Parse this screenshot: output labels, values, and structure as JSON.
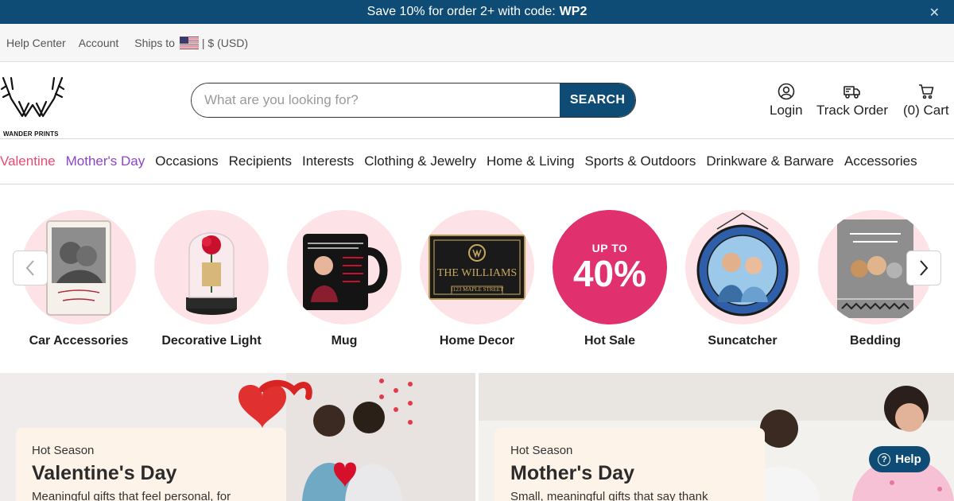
{
  "announcement": {
    "text": "Save 10% for order 2+ with code:",
    "code": "WP2",
    "close_icon": "close-icon"
  },
  "utility": {
    "help_center": "Help Center",
    "account": "Account",
    "ships_to": "Ships to",
    "currency": "| $ (USD)"
  },
  "header": {
    "logo_text": "WANDER PRINTS",
    "search_placeholder": "What are you looking for?",
    "search_button": "SEARCH",
    "login": "Login",
    "track_order": "Track Order",
    "cart": "(0) Cart"
  },
  "nav": {
    "items": [
      "Valentine",
      "Mother's Day",
      "Occasions",
      "Recipients",
      "Interests",
      "Clothing & Jewelry",
      "Home & Living",
      "Sports & Outdoors",
      "Drinkware & Barware",
      "Accessories"
    ]
  },
  "categories": {
    "items": [
      {
        "label": "Car Accessories"
      },
      {
        "label": "Decorative Light"
      },
      {
        "label": "Mug"
      },
      {
        "label": "Home Decor",
        "sign_text": "THE WILLIAMS",
        "sign_sub": "1123 MAPLE STREET"
      },
      {
        "label": "Hot Sale",
        "upto": "UP TO",
        "pct": "40%"
      },
      {
        "label": "Suncatcher"
      },
      {
        "label": "Bedding"
      }
    ]
  },
  "banners": [
    {
      "kicker": "Hot Season",
      "title": "Valentine's Day",
      "sub": "Meaningful gifts that feel personal, for"
    },
    {
      "kicker": "Hot Season",
      "title": "Mother's Day",
      "sub": "Small, meaningful gifts that say thank"
    }
  ],
  "help_widget": {
    "label": "Help"
  },
  "colors": {
    "primary": "#0f4c75",
    "valentine": "#e84a6f",
    "mothers": "#8e44c4",
    "hot_sale": "#e0306d",
    "circle_bg": "#fde2e8",
    "card_bg": "#fdf3e8"
  }
}
